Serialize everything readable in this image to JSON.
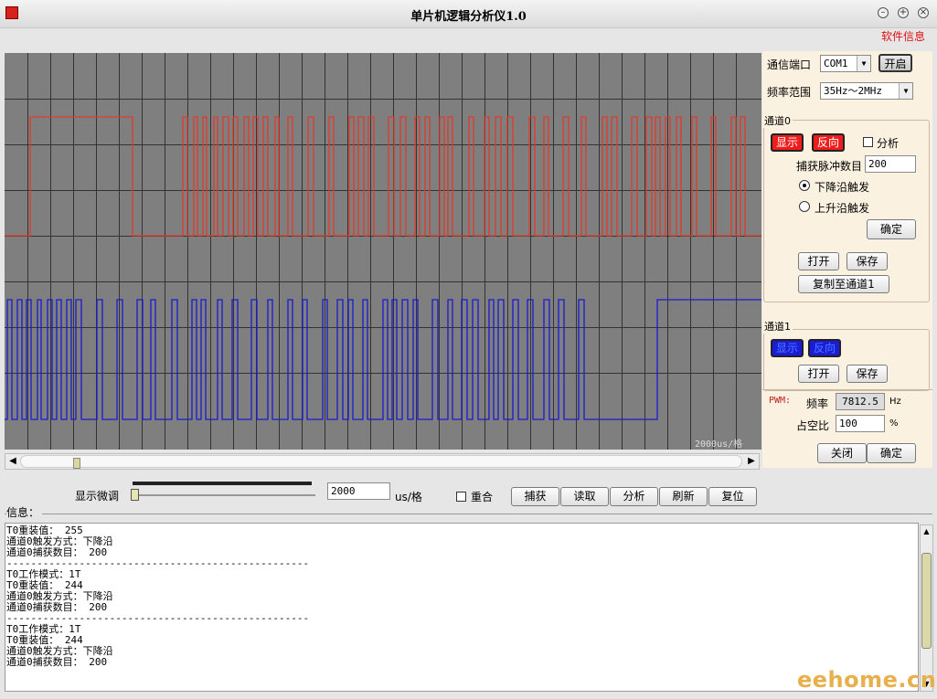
{
  "window": {
    "title": "单片机逻辑分析仪1.0",
    "info_link": "软件信息",
    "buttons": [
      "minimize",
      "maximize",
      "close"
    ]
  },
  "scope": {
    "scale_label": "2000us/格",
    "grid_divisions": {
      "x": 33,
      "y": 8
    },
    "colors": {
      "bg": "#7f7f7f",
      "grid": "#333333",
      "ch0": "#e03a2a",
      "ch1": "#1a1ad0"
    },
    "channel0_edges": [
      28,
      140,
      195,
      200,
      207,
      211,
      217,
      221,
      229,
      233,
      239,
      245,
      250,
      255,
      262,
      267,
      272,
      277,
      283,
      288,
      296,
      300,
      310,
      315,
      332,
      338,
      355,
      360,
      377,
      382,
      387,
      393,
      398,
      404,
      420,
      426,
      433,
      439,
      449,
      454,
      460,
      465,
      476,
      481,
      485,
      490,
      508,
      513,
      525,
      530,
      537,
      543,
      550,
      556,
      574,
      580,
      590,
      595,
      611,
      617,
      631,
      636,
      654,
      659,
      664,
      670,
      686,
      692,
      702,
      708,
      712,
      717,
      723,
      728,
      735,
      740,
      752,
      757,
      773,
      778,
      795,
      800,
      805,
      810
    ],
    "channel0_start_high": false,
    "channel1_edges": [
      3,
      8,
      14,
      19,
      24,
      29,
      36,
      40,
      47,
      52,
      57,
      62,
      68,
      73,
      78,
      84,
      101,
      107,
      123,
      129,
      145,
      151,
      160,
      165,
      183,
      189,
      205,
      210,
      215,
      220,
      233,
      238,
      249,
      255,
      270,
      276,
      288,
      293,
      310,
      315,
      326,
      331,
      348,
      353,
      364,
      370,
      376,
      381,
      392,
      397,
      414,
      419,
      424,
      429,
      435,
      441,
      447,
      452,
      468,
      474,
      485,
      490,
      500,
      506,
      512,
      518,
      530,
      535,
      540,
      546,
      556,
      562,
      572,
      578,
      590,
      596,
      606,
      612,
      628,
      634,
      714
    ],
    "channel1_start_high": false
  },
  "right_panel": {
    "port_label": "通信端口",
    "port_value": "COM1",
    "open_button": "开启",
    "freq_label": "频率范围",
    "freq_value": "35Hz～2MHz",
    "ch0": {
      "title": "通道0",
      "show_button": "显示",
      "invert_button": "反向",
      "analyze_label": "分析",
      "pulse_count_label": "捕获脉冲数目",
      "pulse_count_value": "200",
      "falling_label": "下降沿触发",
      "rising_label": "上升沿触发",
      "ok_button": "确定",
      "open_button": "打开",
      "save_button": "保存",
      "copy_button": "复制至通道1"
    },
    "ch1": {
      "title": "通道1",
      "show_button": "显示",
      "invert_button": "反向",
      "open_button": "打开",
      "save_button": "保存"
    },
    "pwm": {
      "tag": "PWM:",
      "freq_label": "频率",
      "freq_value": "7812.5",
      "freq_unit": "Hz",
      "duty_label": "占空比",
      "duty_value": "100",
      "duty_unit": "%",
      "close_button": "关闭",
      "ok_button": "确定"
    }
  },
  "controls": {
    "fine_tune_label": "显示微调",
    "time_value": "2000",
    "time_unit": "us/格",
    "overlap_label": "重合",
    "buttons": [
      "捕获",
      "读取",
      "分析",
      "刷新",
      "复位"
    ]
  },
  "info": {
    "label": "信息：",
    "lines": [
      "T0重装值： 255",
      "通道0触发方式：下降沿",
      "通道0捕获数目： 200",
      "--------------------------------------------------",
      "T0工作模式：1T",
      "T0重装值： 244",
      "通道0触发方式：下降沿",
      "通道0捕获数目： 200",
      "--------------------------------------------------",
      "T0工作模式：1T",
      "T0重装值： 244",
      "通道0触发方式：下降沿",
      "通道0捕获数目： 200"
    ]
  },
  "watermark": "eehome.cn"
}
